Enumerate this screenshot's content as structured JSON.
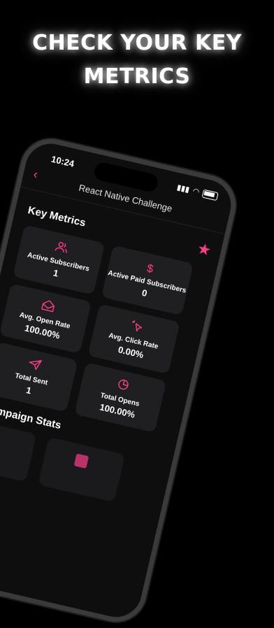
{
  "headline": {
    "line1": "CHECK YOUR KEY",
    "line2": "METRICS"
  },
  "status_bar": {
    "time": "10:24"
  },
  "nav": {
    "title": "React Native Challenge"
  },
  "sections": {
    "key_metrics": "Key Metrics",
    "best_campaign": "est Campaign Stats"
  },
  "metrics": [
    {
      "label": "Active Subscribers",
      "value": "1",
      "icon": "users-icon"
    },
    {
      "label": "Active Paid Subscribers",
      "value": "0",
      "icon": "dollar-icon"
    },
    {
      "label": "Avg. Open Rate",
      "value": "100.00%",
      "icon": "envelope-open-icon"
    },
    {
      "label": "Avg. Click Rate",
      "value": "0.00%",
      "icon": "cursor-click-icon"
    },
    {
      "label": "Total Sent",
      "value": "1",
      "icon": "send-icon"
    },
    {
      "label": "Total Opens",
      "value": "100.00%",
      "icon": "pie-chart-icon"
    }
  ],
  "colors": {
    "accent": "#ff3d8b",
    "background": "#000000",
    "card": "#1f1f21"
  }
}
